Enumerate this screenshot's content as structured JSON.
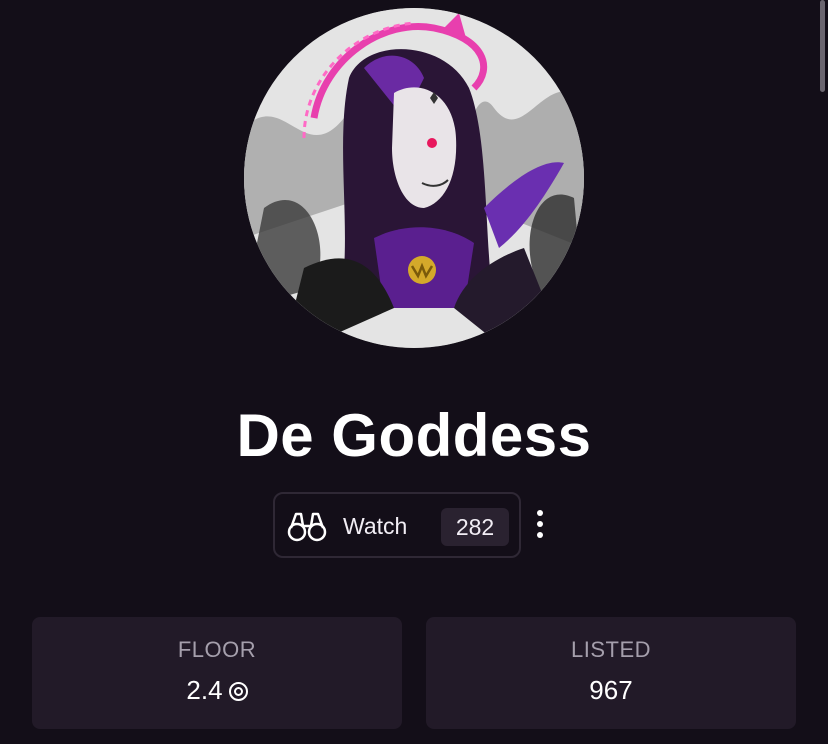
{
  "collection": {
    "name": "De Goddess",
    "avatar_alt": "collection-avatar"
  },
  "watch": {
    "label": "Watch",
    "count": "282",
    "icon": "binoculars-icon"
  },
  "more_icon": "vertical-dots-icon",
  "stats": {
    "floor": {
      "label": "FLOOR",
      "value": "2.4",
      "currency_icon": "sol-coin-icon"
    },
    "listed": {
      "label": "LISTED",
      "value": "967"
    }
  },
  "colors": {
    "background": "#130e18",
    "card": "#221a28",
    "accent_pink": "#e83fae",
    "accent_purple": "#7a2fbf"
  }
}
